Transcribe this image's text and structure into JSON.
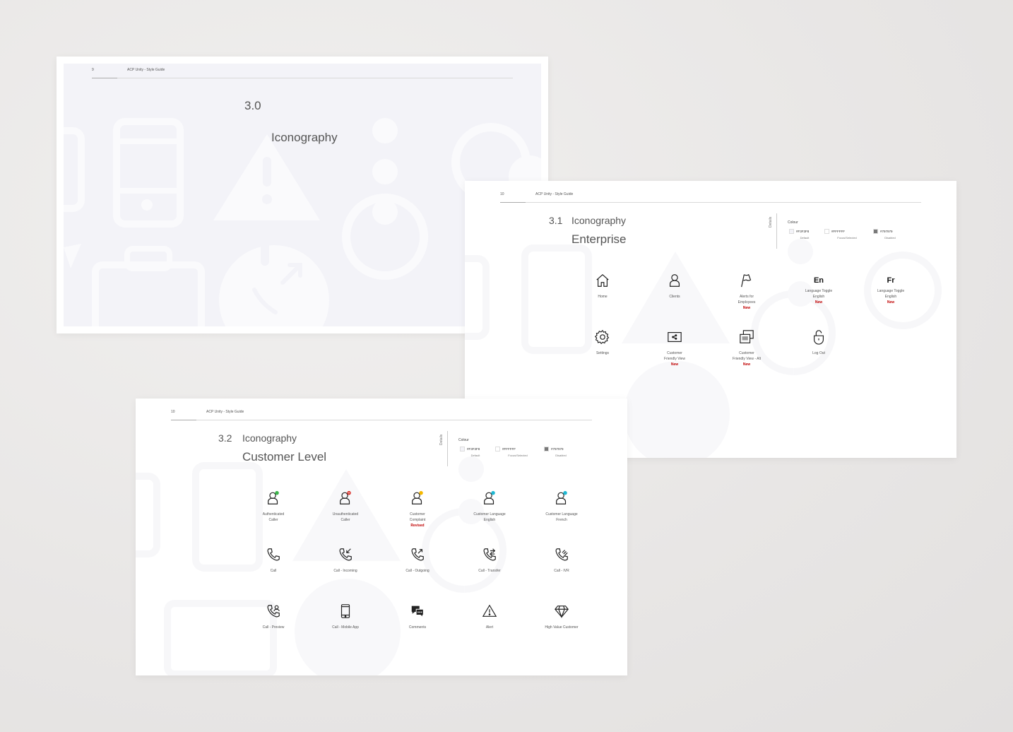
{
  "slide_a": {
    "page_number": "9",
    "doc_title": "ACP Unity - Style Guide",
    "section_number": "3.0",
    "section_title": "Iconography"
  },
  "slide_b": {
    "page_number": "10",
    "doc_title": "ACP Unity - Style Guide",
    "section_number": "3.1",
    "section_title": "Iconography",
    "section_subtitle": "Enterprise",
    "details_label": "Details",
    "colour_label": "Colour",
    "swatches": [
      {
        "hex": "#F3F3F8",
        "name": "Default",
        "color": "#F3F3F8"
      },
      {
        "hex": "#FFFFFF",
        "name": "Focus/Selected",
        "color": "#FFFFFF"
      },
      {
        "hex": "#797979",
        "name": "Disabled",
        "color": "#797979"
      }
    ],
    "icons": [
      {
        "label": "Home",
        "tag": ""
      },
      {
        "label": "Clients",
        "tag": ""
      },
      {
        "label": "Alerts for\nEmployees",
        "tag": "New"
      },
      {
        "label": "Language Toggle\nEnglish",
        "tag": "New",
        "glyph": "En"
      },
      {
        "label": "Language Toggle\nEnglish",
        "tag": "New",
        "glyph": "Fr"
      },
      {
        "label": "Settings",
        "tag": ""
      },
      {
        "label": "Customer\nFriendly View",
        "tag": "New"
      },
      {
        "label": "Customer\nFriendly View - Alt",
        "tag": "New"
      },
      {
        "label": "Log Out",
        "tag": ""
      }
    ]
  },
  "slide_c": {
    "page_number": "10",
    "doc_title": "ACP Unity - Style Guide",
    "section_number": "3.2",
    "section_title": "Iconography",
    "section_subtitle": "Customer Level",
    "details_label": "Details",
    "colour_label": "Colour",
    "swatches": [
      {
        "hex": "#F3F3F8",
        "name": "Default",
        "color": "#F3F3F8"
      },
      {
        "hex": "#FFFFFF",
        "name": "Focus/Selected",
        "color": "#FFFFFF"
      },
      {
        "hex": "#797979",
        "name": "Disabled",
        "color": "#797979"
      }
    ],
    "icons": [
      {
        "label": "Authenticated\nCaller",
        "tag": ""
      },
      {
        "label": "Unauthenticated\nCaller",
        "tag": ""
      },
      {
        "label": "Customer\nComplaint",
        "tag": "Revised"
      },
      {
        "label": "Customer Language\nEnglish",
        "tag": ""
      },
      {
        "label": "Customer Language\nFrench",
        "tag": ""
      },
      {
        "label": "Call",
        "tag": ""
      },
      {
        "label": "Call - Incoming",
        "tag": ""
      },
      {
        "label": "Call - Outgoing",
        "tag": ""
      },
      {
        "label": "Call - Transfer",
        "tag": ""
      },
      {
        "label": "Call - IVR",
        "tag": ""
      },
      {
        "label": "Call - Preview",
        "tag": ""
      },
      {
        "label": "Call - Mobile App",
        "tag": ""
      },
      {
        "label": "Comments",
        "tag": ""
      },
      {
        "label": "Alert",
        "tag": ""
      },
      {
        "label": "High Value Customer",
        "tag": ""
      }
    ],
    "status_colors": {
      "authenticated": "#3cb44b",
      "unauthenticated": "#d9322b",
      "complaint": "#f5b800",
      "english": "#1fb8d3",
      "french": "#1fb8d3"
    }
  }
}
